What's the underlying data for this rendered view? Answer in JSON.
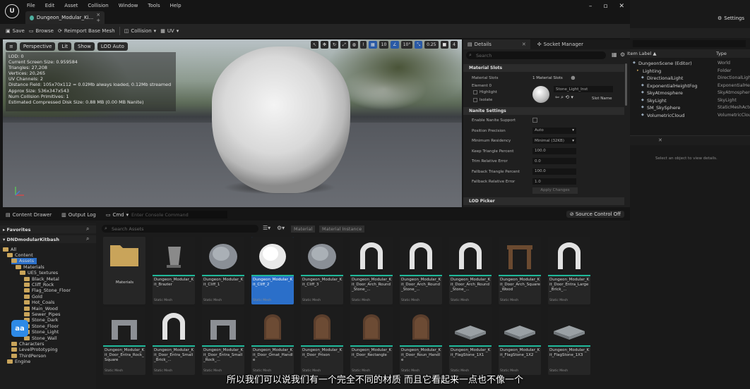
{
  "menu": [
    "File",
    "Edit",
    "Asset",
    "Collision",
    "Window",
    "Tools",
    "Help"
  ],
  "doc_tab": {
    "label": "Dungeon_Modular_Ki...",
    "suffix": "× +"
  },
  "logo_text": "U",
  "toolbar": {
    "save": "Save",
    "browse": "Browse",
    "reimport": "Reimport Base Mesh",
    "collision": "Collision",
    "uv": "UV"
  },
  "viewport": {
    "perspective": "Perspective",
    "lit": "Lit",
    "show": "Show",
    "lod": "LOD Auto",
    "grid_snap": "10",
    "rot_snap": "10°",
    "scale_snap": "0.25",
    "cam_speed": "4",
    "stats": [
      "LOD: 0",
      "Current Screen Size: 0.959584",
      "Triangles: 27,208",
      "Vertices: 20,265",
      "UV Channels: 2",
      "Distance Field: 105x70x112 = 0.02Mb always loaded, 0.12Mb streamed",
      "Approx Size: 536x347x543",
      "Num Collision Primitives: 1",
      "Estimated Compressed Disk Size: 0.88 MB (0.00 MB Nanite)"
    ]
  },
  "details": {
    "tab1": "Details",
    "tab2": "Socket Manager",
    "search_placeholder": "Search",
    "material_slots_header": "Material Slots",
    "material_slots_label": "Material Slots",
    "material_slots_value": "1 Material Slots",
    "element0": "Element 0",
    "highlight": "Highlight",
    "isolate": "Isolate",
    "material_name": "Stone_Light_Inst",
    "slot_name": "Slot Name",
    "nanite_header": "Nanite Settings",
    "nanite_props": [
      {
        "label": "Enable Nanite Support",
        "value": ""
      },
      {
        "label": "Position Precision",
        "value": "Auto"
      },
      {
        "label": "Minimum Residency",
        "value": "Minimal (32KB)"
      },
      {
        "label": "Keep Triangle Percent",
        "value": "100.0"
      },
      {
        "label": "Trim Relative Error",
        "value": "0.0"
      },
      {
        "label": "Fallback Triangle Percent",
        "value": "100.0"
      },
      {
        "label": "Fallback Relative Error",
        "value": "1.0"
      }
    ],
    "apply": "Apply Changes",
    "lod_header": "LOD Picker"
  },
  "right_panel": {
    "settings": "Settings",
    "col_label": "Item Label ▲",
    "col_type": "Type",
    "rows": [
      {
        "name": "DungeonScene (Editor)",
        "type": "World"
      },
      {
        "name": "Lighting",
        "type": "Folder"
      },
      {
        "name": "DirectionalLight",
        "type": "DirectionalLight"
      },
      {
        "name": "ExponentialHeightFog",
        "type": "ExponentialHeightFog"
      },
      {
        "name": "SkyAtmosphere",
        "type": "SkyAtmosphere"
      },
      {
        "name": "SkyLight",
        "type": "SkyLight"
      },
      {
        "name": "SM_SkySphere",
        "type": "StaticMeshActor"
      },
      {
        "name": "VolumetricCloud",
        "type": "VolumetricCloud"
      }
    ],
    "select_msg": "Select an object to view details."
  },
  "bottom": {
    "content_drawer": "Content Drawer",
    "output_log": "Output Log",
    "cmd": "Cmd",
    "cmd_placeholder": "Enter Console Command",
    "source_control": "Source Control Off",
    "favorites": "Favorites",
    "project": "DNDmodularKitbash",
    "search_placeholder": "Search Assets",
    "chip_material": "Material",
    "chip_material_instance": "Material Instance",
    "tree": [
      {
        "label": "All",
        "depth": 0
      },
      {
        "label": "Content",
        "depth": 1
      },
      {
        "label": "Assets",
        "depth": 2
      },
      {
        "label": "Materials",
        "depth": 3
      },
      {
        "label": "UE5_textures",
        "depth": 4
      },
      {
        "label": "Black_Metal",
        "depth": 5
      },
      {
        "label": "Cliff_Rock",
        "depth": 5
      },
      {
        "label": "Flag_Stone_Floor",
        "depth": 5
      },
      {
        "label": "Gold",
        "depth": 5
      },
      {
        "label": "Hot_Coals",
        "depth": 5
      },
      {
        "label": "Main_Wood",
        "depth": 5
      },
      {
        "label": "Sewer_Pipes",
        "depth": 5
      },
      {
        "label": "Stone_Dark",
        "depth": 5
      },
      {
        "label": "Stone_Floor",
        "depth": 5
      },
      {
        "label": "Stone_Light",
        "depth": 5
      },
      {
        "label": "Stone_Wall",
        "depth": 5
      },
      {
        "label": "Characters",
        "depth": 2
      },
      {
        "label": "LevelPrototyping",
        "depth": 2
      },
      {
        "label": "ThirdPerson",
        "depth": 2
      },
      {
        "label": "Engine",
        "depth": 1
      }
    ],
    "assets_row1": [
      {
        "name": "Materials",
        "type": "",
        "kind": "folder"
      },
      {
        "name": "Dungeon_Modular_Kit_Brazier",
        "type": "Static Mesh",
        "kind": "brazier"
      },
      {
        "name": "Dungeon_Modular_Kit_Cliff_1",
        "type": "Static Mesh",
        "kind": "rock"
      },
      {
        "name": "Dungeon_Modular_Kit_Cliff_2",
        "type": "Static Mesh",
        "kind": "rockw"
      },
      {
        "name": "Dungeon_Modular_Kit_Cliff_3",
        "type": "Static Mesh",
        "kind": "rock"
      },
      {
        "name": "Dungeon_Modular_Kit_Door_Arch_Round_Stone_...",
        "type": "Static Mesh",
        "kind": "arch"
      },
      {
        "name": "Dungeon_Modular_Kit_Door_Arch_Round_Stone_...",
        "type": "Static Mesh",
        "kind": "arch"
      },
      {
        "name": "Dungeon_Modular_Kit_Door_Arch_Round_Stone_...",
        "type": "Static Mesh",
        "kind": "arch"
      },
      {
        "name": "Dungeon_Modular_Kit_Door_Arch_Square_Wood",
        "type": "Static Mesh",
        "kind": "wood"
      },
      {
        "name": "Dungeon_Modular_Kit_Door_Entra_Large_Brick_...",
        "type": "Static Mesh",
        "kind": "arch"
      }
    ],
    "assets_row2": [
      {
        "name": "Dungeon_Modular_Kit_Door_Entra_Rock_Square",
        "type": "Static Mesh",
        "kind": "brick"
      },
      {
        "name": "Dungeon_Modular_Kit_Door_Entra_Small_Brick_...",
        "type": "Static Mesh",
        "kind": "arch"
      },
      {
        "name": "Dungeon_Modular_Kit_Door_Entra_Small_Rock_...",
        "type": "Static Mesh",
        "kind": "brick"
      },
      {
        "name": "Dungeon_Modular_Kit_Door_Ornat_Handle",
        "type": "Static Mesh",
        "kind": "door"
      },
      {
        "name": "Dungeon_Modular_Kit_Door_Prison",
        "type": "Static Mesh",
        "kind": "door"
      },
      {
        "name": "Dungeon_Modular_Kit_Door_Rectangle",
        "type": "Static Mesh",
        "kind": "door"
      },
      {
        "name": "Dungeon_Modular_Kit_Door_Roun_Handle",
        "type": "Static Mesh",
        "kind": "door"
      },
      {
        "name": "Dungeon_Modular_Kit_FlagStone_1X1",
        "type": "Static Mesh",
        "kind": "slab"
      },
      {
        "name": "Dungeon_Modular_Kit_FlagStone_1X2",
        "type": "Static Mesh",
        "kind": "slab"
      },
      {
        "name": "Dungeon_Modular_Kit_FlagStone_1X3",
        "type": "Static Mesh",
        "kind": "slab"
      }
    ]
  },
  "overlay_badge": "aa",
  "subtitle": "所以我们可以说我们有一个完全不同的材质 而且它看起来一点也不像一个",
  "colors": {
    "accent": "#2b6fc9",
    "mesh_bar": "#1fb89a",
    "folder": "#c9a45a"
  }
}
